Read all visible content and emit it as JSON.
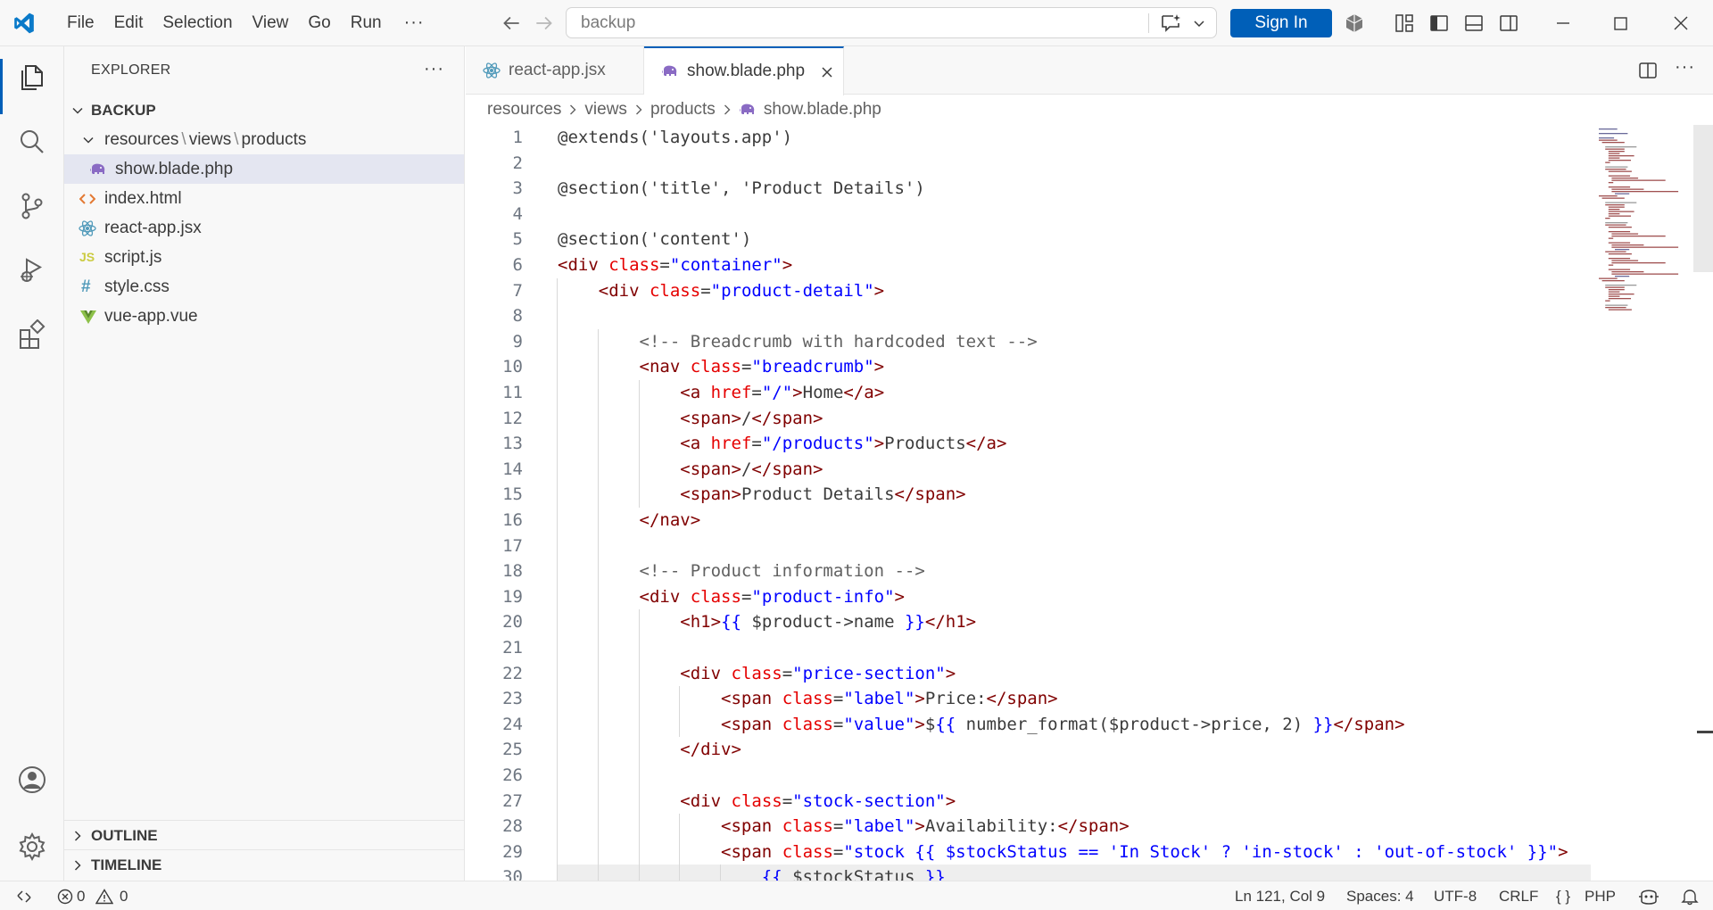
{
  "titlebar": {
    "menu": [
      "File",
      "Edit",
      "Selection",
      "View",
      "Go",
      "Run"
    ],
    "more": "···",
    "command_center": "backup",
    "sign_in": "Sign In"
  },
  "sidebar": {
    "title": "EXPLORER",
    "more": "···",
    "root": "BACKUP",
    "folder_path": [
      "resources",
      "views",
      "products"
    ],
    "folder_sep": "\\",
    "files": [
      {
        "name": "show.blade.php",
        "icon": "php-elephant-icon",
        "selected": true
      },
      {
        "name": "index.html",
        "icon": "html-icon"
      },
      {
        "name": "react-app.jsx",
        "icon": "react-icon"
      },
      {
        "name": "script.js",
        "icon": "js-icon",
        "icon_text": "JS"
      },
      {
        "name": "style.css",
        "icon": "css-icon",
        "icon_text": "#"
      },
      {
        "name": "vue-app.vue",
        "icon": "vue-icon"
      }
    ],
    "outline": "OUTLINE",
    "timeline": "TIMELINE"
  },
  "tabs": [
    {
      "label": "react-app.jsx",
      "active": false
    },
    {
      "label": "show.blade.php",
      "active": true
    }
  ],
  "breadcrumb": [
    "resources",
    "views",
    "products",
    "show.blade.php"
  ],
  "code_lines": [
    "@extends('layouts.app')",
    "",
    "@section('title', 'Product Details')",
    "",
    "@section('content')",
    "<div class=\"container\">",
    "    <div class=\"product-detail\">",
    "",
    "        <!-- Breadcrumb with hardcoded text -->",
    "        <nav class=\"breadcrumb\">",
    "            <a href=\"/\">Home</a>",
    "            <span>/</span>",
    "            <a href=\"/products\">Products</a>",
    "            <span>/</span>",
    "            <span>Product Details</span>",
    "        </nav>",
    "",
    "        <!-- Product information -->",
    "        <div class=\"product-info\">",
    "            <h1>{{ $product->name }}</h1>",
    "",
    "            <div class=\"price-section\">",
    "                <span class=\"label\">Price:</span>",
    "                <span class=\"value\">${{ number_format($product->price, 2) }}</span>",
    "            </div>",
    "",
    "            <div class=\"stock-section\">",
    "                <span class=\"label\">Availability:</span>",
    "                <span class=\"stock {{ $stockStatus == 'In Stock' ? 'in-stock' : 'out-of-stock' }}\">",
    "                    {{ $stockStatus }}"
  ],
  "statusbar": {
    "errors": "0",
    "warnings": "0",
    "position": "Ln 121, Col 9",
    "spaces": "Spaces: 4",
    "encoding": "UTF-8",
    "eol": "CRLF",
    "language_braces": "{ }",
    "language": "PHP"
  },
  "colors": {
    "accent": "#005fb8",
    "tag": "#800000",
    "attribute": "#e50000",
    "string": "#0000ff",
    "comment": "#616161"
  }
}
